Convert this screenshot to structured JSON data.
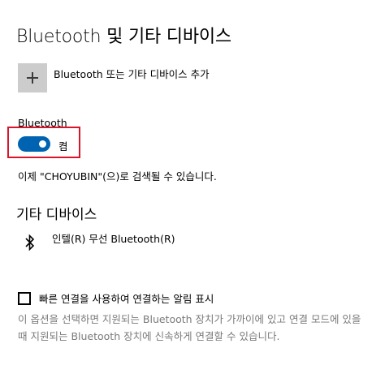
{
  "header": {
    "title": "Bluetooth 및 기타 디바이스"
  },
  "add_device": {
    "icon": "plus-icon",
    "label": "Bluetooth 또는 기타 디바이스 추가"
  },
  "bluetooth": {
    "label": "Bluetooth",
    "toggle_state": "켬",
    "toggle_on": true,
    "toggle_color": "#0063b1",
    "highlight_color": "#d8162b",
    "discoverable_text": "이제 \"CHOYUBIN\"(으)로 검색될 수 있습니다."
  },
  "other_devices": {
    "title": "기타 디바이스",
    "devices": [
      {
        "icon": "bluetooth-icon",
        "name": "인텔(R) 무선 Bluetooth(R)"
      }
    ]
  },
  "swift_pair": {
    "checked": false,
    "label": "빠른 연결을 사용하여 연결하는 알림 표시",
    "description": "이 옵션을 선택하면 지원되는 Bluetooth 장치가 가까이에 있고 연결 모드에 있을 때 지원되는 Bluetooth 장치에 신속하게 연결할 수 있습니다."
  }
}
